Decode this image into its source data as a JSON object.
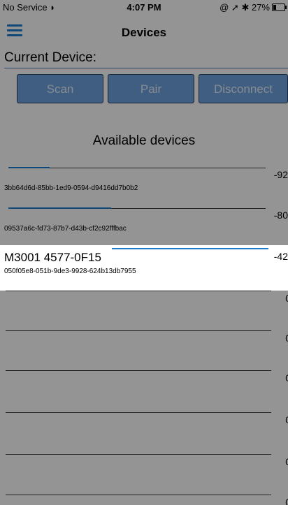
{
  "status_bar": {
    "carrier": "No Service",
    "wifi_icon": "wifi-icon",
    "time": "4:07 PM",
    "right_text": "@ ➚ ✱ 27%",
    "battery_percent": 27
  },
  "nav": {
    "menu_icon": "hamburger-menu-icon",
    "title": "Devices"
  },
  "current_device_label": "Current Device:",
  "buttons": {
    "scan": "Scan",
    "pair": "Pair",
    "disconnect": "Disconnect"
  },
  "available_title": "Available devices",
  "devices": [
    {
      "name": "",
      "uuid": "3bb64d6d-85bb-1ed9-0594-d9416dd7b0b2",
      "rssi": "-92",
      "signal_fraction": 0.16
    },
    {
      "name": "",
      "uuid": "09537a6c-fd73-87b7-d43b-cf2c92fffbac",
      "rssi": "-80",
      "signal_fraction": 0.4
    },
    {
      "name": "M3001 4577-0F15",
      "uuid": "050f05e8-051b-9de3-9928-624b13db7955",
      "rssi": "-42",
      "signal_fraction": 1.0
    }
  ],
  "empty_rows": [
    {
      "value": "0"
    },
    {
      "value": "0"
    },
    {
      "value": "0"
    },
    {
      "value": "0"
    },
    {
      "value": "0"
    },
    {
      "value": "0"
    },
    {
      "value": "0"
    }
  ],
  "colors": {
    "accent": "#1c7bd1",
    "button_fill": "#6ea2e0",
    "overlay": "rgba(0,0,0,0.42)"
  }
}
